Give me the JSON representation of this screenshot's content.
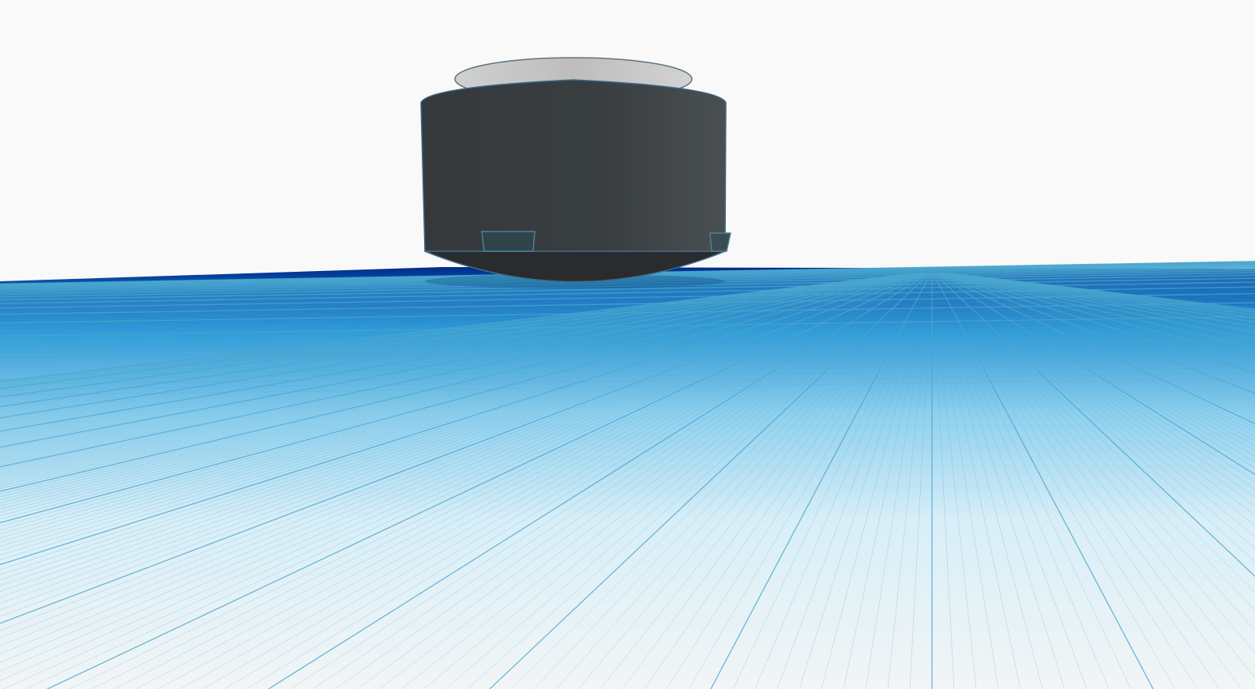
{
  "scene": {
    "background_color": "#f9f9f9",
    "workplane": {
      "horizon_color": "#002a86",
      "mid_color": "#3aa6e0",
      "near_color": "#eef6fa",
      "grid_line_color": "#4aa7cf"
    },
    "object": {
      "body_color": "#3a3e41",
      "bottom_color": "#292b2d",
      "top_rim_color": "#c9c9c9",
      "edge_color": "#3e6a8a",
      "slot_color": "#2f4548"
    }
  }
}
